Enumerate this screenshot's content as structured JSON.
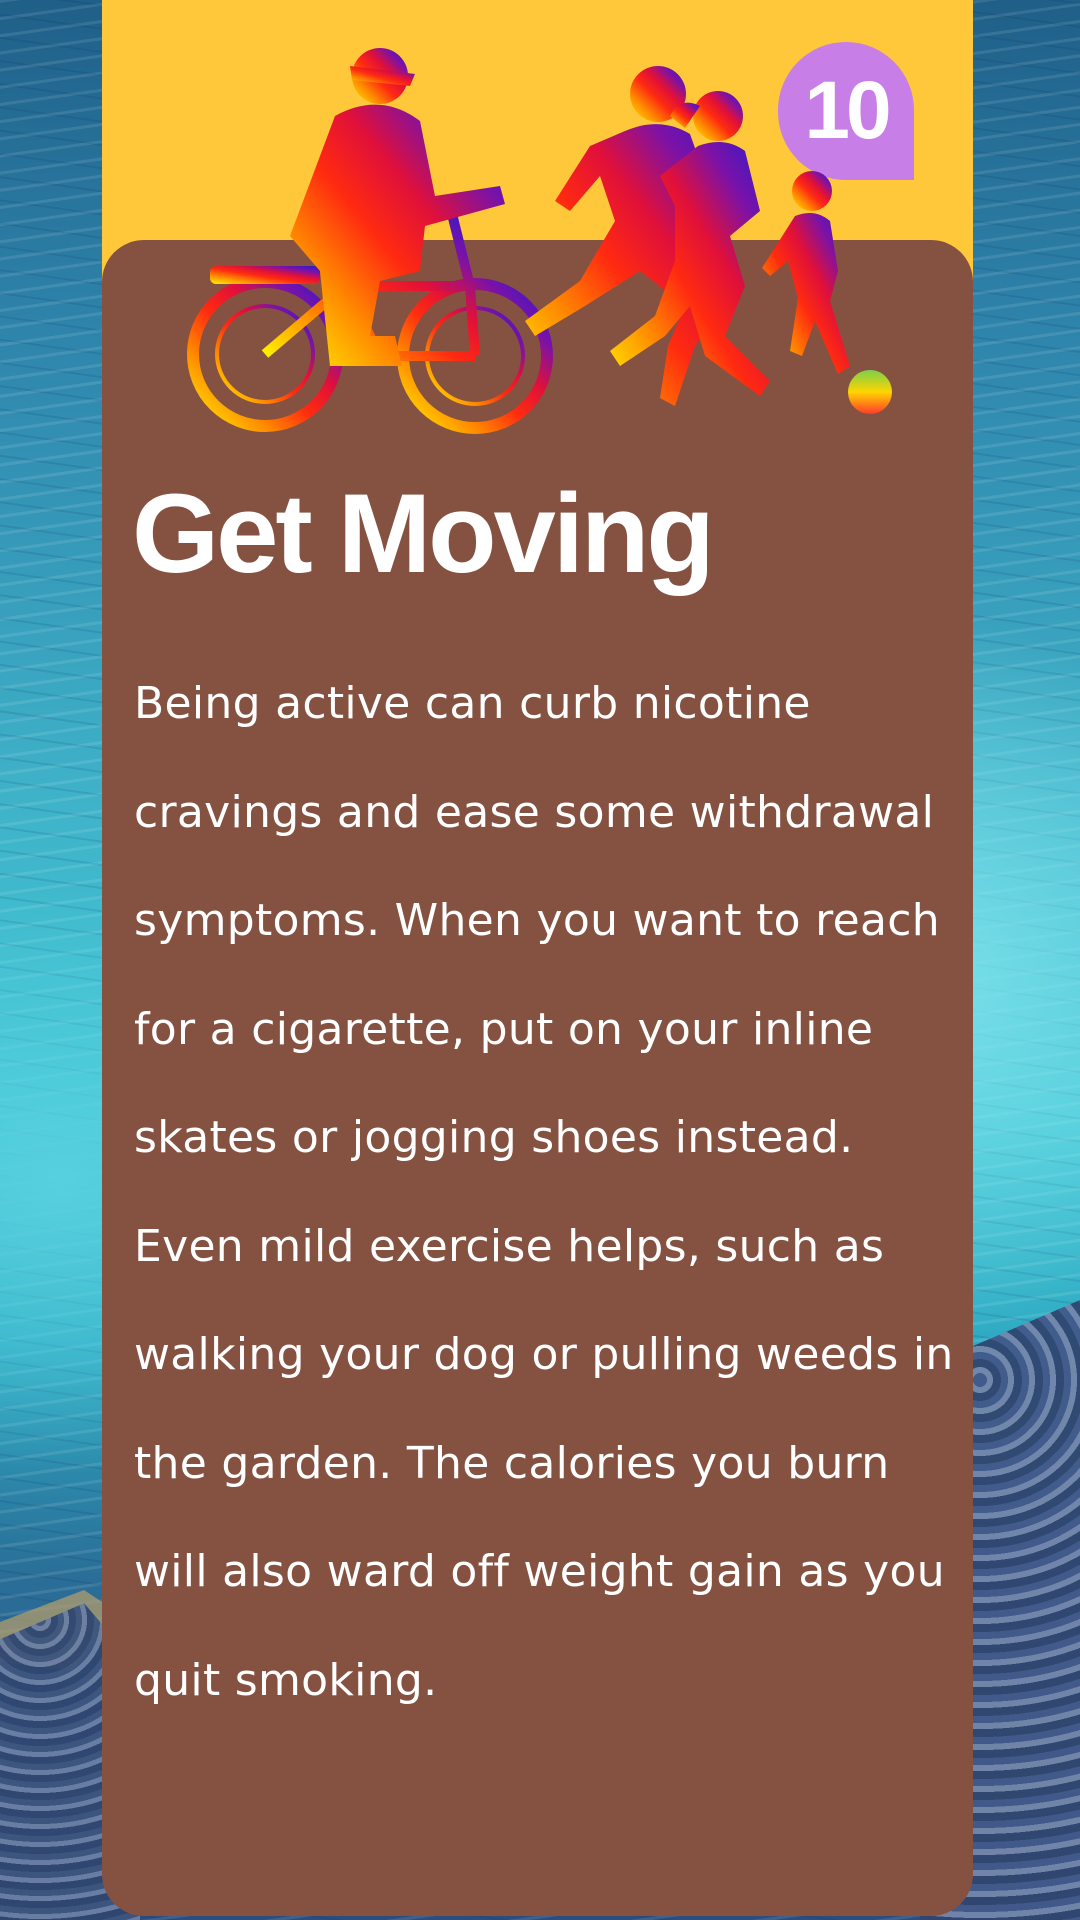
{
  "card": {
    "badge_number": "10",
    "title": "Get Moving",
    "body": "Being active can curb nicotine cravings and ease some withdrawal symptoms. When you want to reach for a cigarette, put on your inline skates or jogging shoes instead. Even mild exercise helps, such as walking your dog or pulling weeds in the garden. The calories you burn will also ward off weight gain as you quit smoking."
  },
  "colors": {
    "header": "#ffc83a",
    "card": "#855242",
    "badge": "#c77ee6",
    "text": "#ffffff"
  },
  "illustration": {
    "icons": [
      "cyclist-icon",
      "runner-icon",
      "runner-woman-icon",
      "child-runner-icon",
      "ball-icon"
    ]
  }
}
